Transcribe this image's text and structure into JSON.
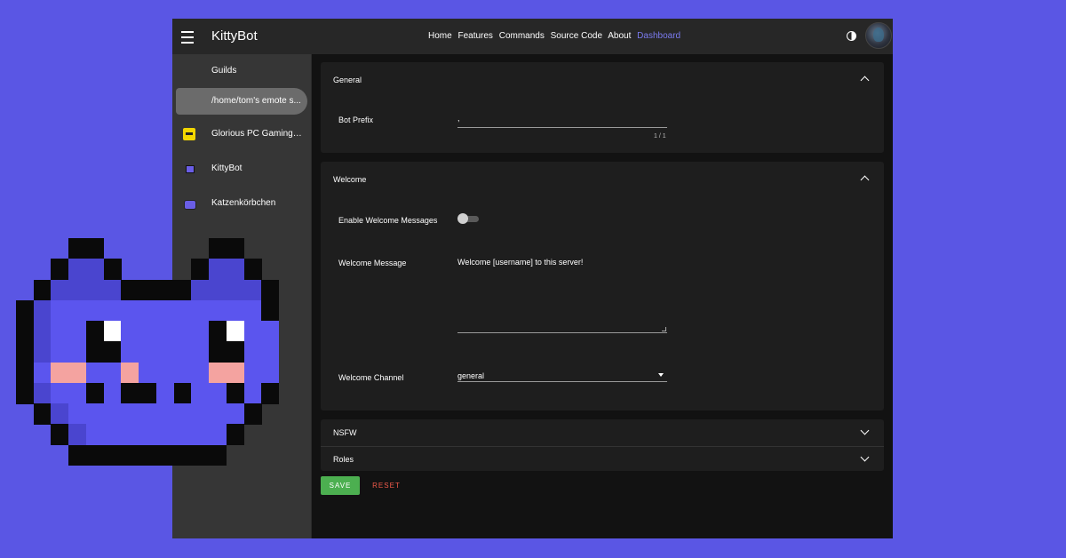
{
  "colors": {
    "background": "#5a56e4",
    "accent": "#7b7bf0",
    "save": "#4caf50",
    "reset": "#f05a4a",
    "mascot_fill": "#5b55ee",
    "mascot_dark": "#4a45cf",
    "mascot_cheek": "#f4a3a0"
  },
  "header": {
    "title": "KittyBot",
    "nav": [
      "Home",
      "Features",
      "Commands",
      "Source Code",
      "About",
      "Dashboard"
    ],
    "active_nav": "Dashboard",
    "theme_icon": "contrast-icon",
    "avatar_icon": "user-avatar"
  },
  "sidebar": {
    "heading": "Guilds",
    "items": [
      {
        "label": "/home/tom's emote s...",
        "icon": "",
        "selected": true
      },
      {
        "label": "Glorious PC Gaming ...",
        "icon": "glorious-guild-icon",
        "selected": false
      },
      {
        "label": "KittyBot",
        "icon": "kittybot-guild-icon",
        "selected": false
      },
      {
        "label": "Katzenkörbchen",
        "icon": "katzenkorbchen-guild-icon",
        "selected": false
      }
    ]
  },
  "panels": {
    "general": {
      "title": "General",
      "prefix_label": "Bot Prefix",
      "prefix_value": ",",
      "prefix_counter": "1 / 1"
    },
    "welcome": {
      "title": "Welcome",
      "enable_label": "Enable Welcome Messages",
      "enable_value": false,
      "message_label": "Welcome Message",
      "message_value": "Welcome [username] to this server!",
      "channel_label": "Welcome Channel",
      "channel_value": "general"
    },
    "nsfw": {
      "title": "NSFW"
    },
    "roles": {
      "title": "Roles"
    }
  },
  "actions": {
    "save": "SAVE",
    "reset": "RESET"
  }
}
